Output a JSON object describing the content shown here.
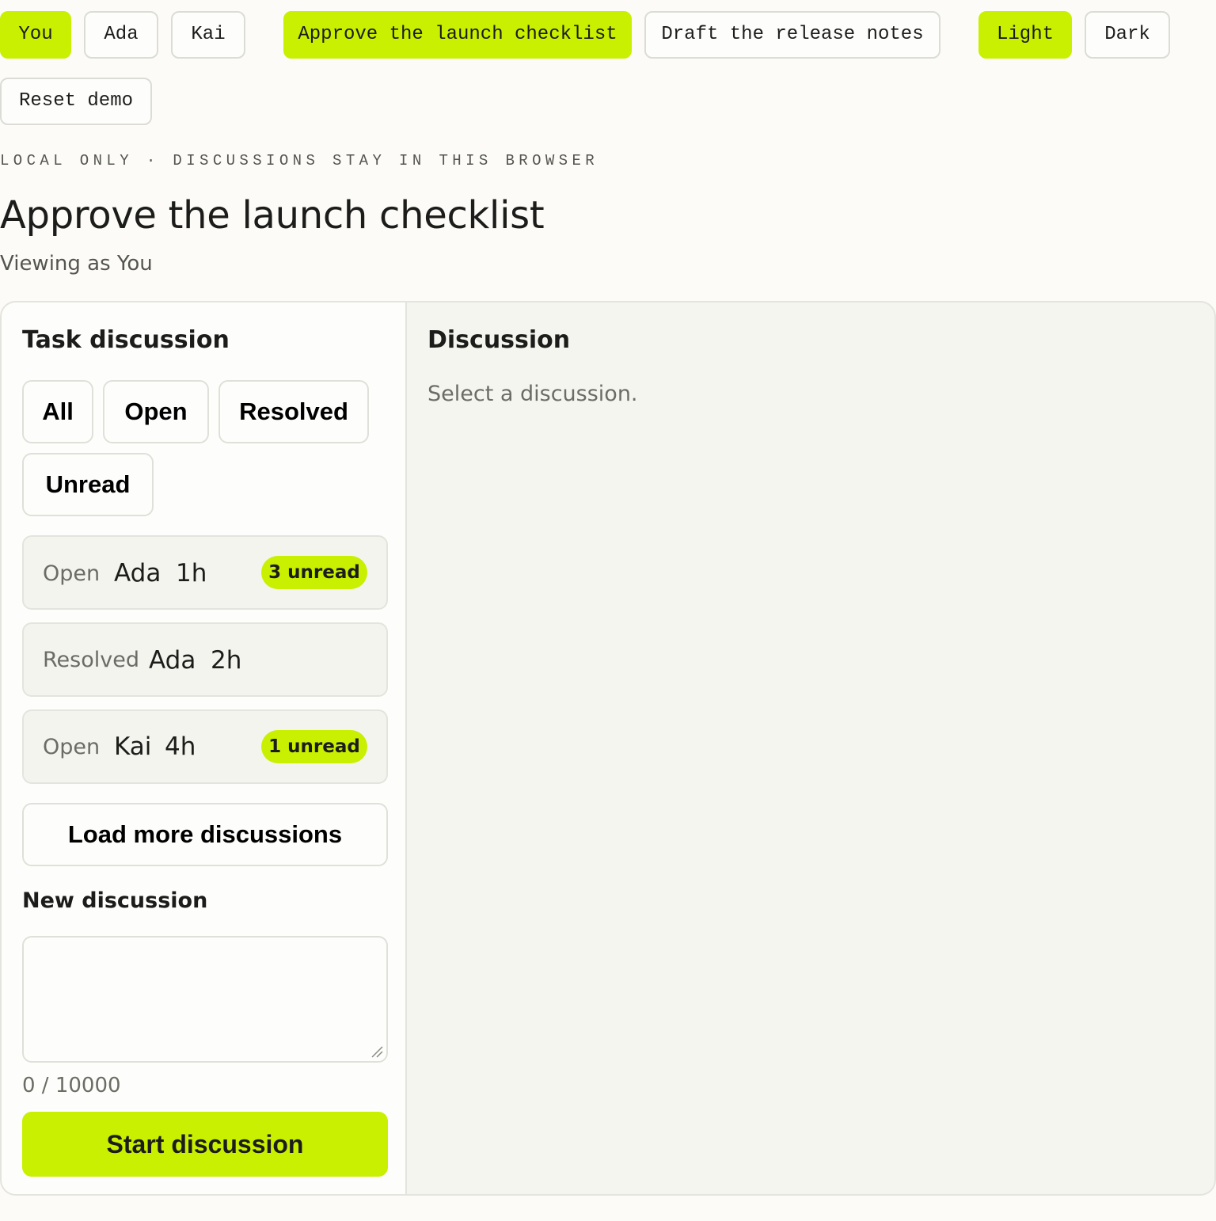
{
  "toolbar": {
    "users": [
      "You",
      "Ada",
      "Kai"
    ],
    "active_user": "You",
    "tasks": [
      "Approve the launch checklist",
      "Draft the release notes"
    ],
    "active_task": "Approve the launch checklist",
    "themes": [
      "Light",
      "Dark"
    ],
    "active_theme": "Light",
    "reset_label": "Reset demo"
  },
  "header": {
    "eyebrow": "LOCAL ONLY · DISCUSSIONS STAY IN THIS BROWSER",
    "title": "Approve the launch checklist",
    "viewing_as": "Viewing as You"
  },
  "left_panel": {
    "title": "Task discussion",
    "filters": [
      "All",
      "Open",
      "Resolved",
      "Unread"
    ],
    "discussions": [
      {
        "status": "Open",
        "author": "Ada",
        "age": "1h",
        "unread": "3 unread"
      },
      {
        "status": "Resolved",
        "author": "Ada",
        "age": "2h",
        "unread": ""
      },
      {
        "status": "Open",
        "author": "Kai",
        "age": "4h",
        "unread": "1 unread"
      }
    ],
    "load_more_label": "Load more discussions",
    "new_discussion_label": "New discussion",
    "textarea_value": "",
    "char_count": "0 / 10000",
    "start_label": "Start discussion"
  },
  "right_panel": {
    "title": "Discussion",
    "empty_message": "Select a discussion."
  },
  "colors": {
    "accent": "#c8f000",
    "background": "#fcfbf8",
    "panel_muted": "#f5f5f0",
    "border": "#e4e4de",
    "text": "#1c1c1a",
    "muted_text": "#6c6c66"
  }
}
